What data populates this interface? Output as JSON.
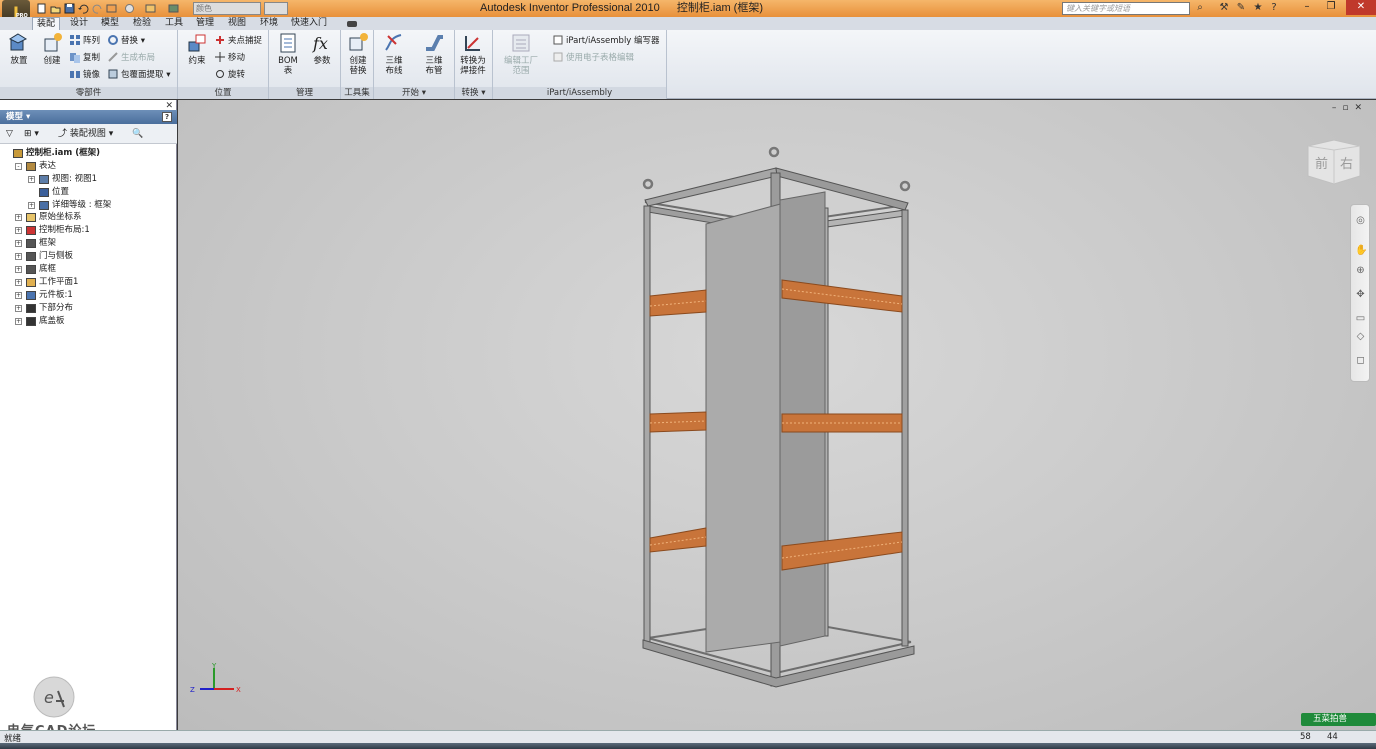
{
  "titlebar": {
    "app_logo": "I",
    "app_logo_sub": "PRO",
    "app_name": "Autodesk Inventor Professional 2010",
    "document": "控制柜.iam (框架)",
    "material_combo": "颜色",
    "search_placeholder": "键入关键字或短语"
  },
  "tabs": [
    {
      "label": "装配",
      "active": true
    },
    {
      "label": "设计"
    },
    {
      "label": "模型"
    },
    {
      "label": "检验"
    },
    {
      "label": "工具"
    },
    {
      "label": "管理"
    },
    {
      "label": "视图"
    },
    {
      "label": "环境"
    },
    {
      "label": "快速入门"
    }
  ],
  "ribbon": {
    "panels": {
      "components": "零部件",
      "position": "位置",
      "manage": "管理",
      "toolset": "工具集",
      "begin": "开始 ▾",
      "convert": "转换 ▾",
      "ipart": "iPart/iAssembly"
    },
    "buttons": {
      "place": "放置",
      "create": "创建",
      "pattern": "阵列",
      "copy": "复制",
      "mirror": "镜像",
      "substitute": "替换",
      "make_layout": "生成布局",
      "shrinkwrap": "包覆面提取",
      "constrain": "约束",
      "grip_snap": "夹点捕捉",
      "move": "移动",
      "rotate": "旋转",
      "bom": "BOM\n表",
      "parameters": "参数",
      "create_substitute": "创建\n替换",
      "route_3d": "三维\n布线",
      "tube_3d": "三维\n布管",
      "convert_weldment": "转换为\n焊接件",
      "edit_factory": "编辑工厂\n范围",
      "ipart_author": "iPart/iAssembly 编写器",
      "use_spreadsheet": "使用电子表格编辑"
    }
  },
  "browser": {
    "header": "模型 ▾",
    "help": "?",
    "assembly_view": "装配视图",
    "tree": [
      {
        "label": "控制柜.iam (框架)",
        "level": 0,
        "root": true,
        "icon": "assembly-icon"
      },
      {
        "label": "表达",
        "level": 1,
        "exp": "-",
        "icon": "representation-icon"
      },
      {
        "label": "视图: 视图1",
        "level": 2,
        "exp": "+",
        "icon": "view-icon"
      },
      {
        "label": "位置",
        "level": 2,
        "icon": "position-icon"
      },
      {
        "label": "详细等级 : 框架",
        "level": 2,
        "exp": "+",
        "icon": "lod-icon"
      },
      {
        "label": "原始坐标系",
        "level": 1,
        "exp": "+",
        "icon": "folder-icon"
      },
      {
        "label": "控制柜布局:1",
        "level": 1,
        "exp": "+",
        "icon": "layout-icon"
      },
      {
        "label": "框架",
        "level": 1,
        "exp": "+",
        "icon": "frame-icon"
      },
      {
        "label": "门与侧板",
        "level": 1,
        "exp": "+",
        "icon": "door-icon"
      },
      {
        "label": "底框",
        "level": 1,
        "exp": "+",
        "icon": "base-icon"
      },
      {
        "label": "工作平面1",
        "level": 1,
        "exp": "+",
        "icon": "workplane-icon"
      },
      {
        "label": "元件板:1",
        "level": 1,
        "exp": "+",
        "icon": "part-icon"
      },
      {
        "label": "下部分布",
        "level": 1,
        "exp": "+",
        "icon": "pattern-icon"
      },
      {
        "label": "底盖板",
        "level": 1,
        "exp": "+",
        "icon": "pattern-icon"
      }
    ]
  },
  "viewcube": {
    "front": "前",
    "right": "右"
  },
  "axis": {
    "x": "X",
    "y": "Y",
    "z": "Z"
  },
  "status": {
    "text": "就绪",
    "num1": "58",
    "num2": "44",
    "badge": "五菜拍兽"
  },
  "watermark": "电气CAD论坛",
  "colors": {
    "accent": "#e8903a",
    "rail": "#c8743a",
    "badge": "#1f8a3a"
  }
}
